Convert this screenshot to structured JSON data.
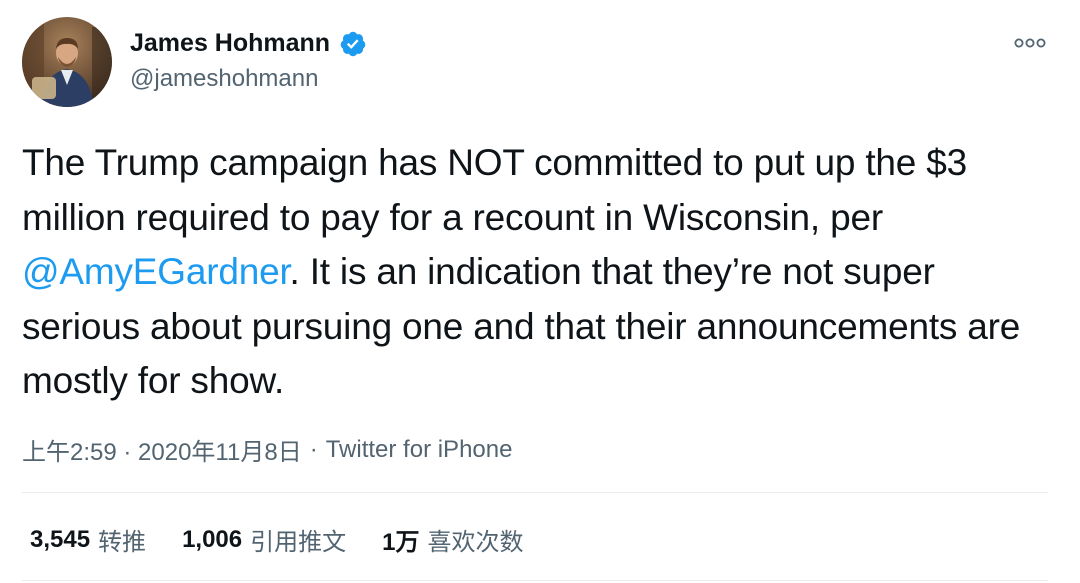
{
  "author": {
    "display_name": "James Hohmann",
    "handle": "@jameshohmann",
    "verified": true
  },
  "tweet": {
    "text_before_mention": "The Trump campaign has NOT committed to put up the $3 million required to pay for a recount in Wisconsin, per ",
    "mention": "@AmyEGardner",
    "text_after_mention": ". It is an indication that they’re not super serious about pursuing one and that their announcements are mostly for show."
  },
  "meta": {
    "timestamp": "上午2:59 · 2020年11月8日",
    "separator": "·",
    "source": "Twitter for iPhone"
  },
  "stats": [
    {
      "count": "3,545",
      "label": "转推"
    },
    {
      "count": "1,006",
      "label": "引用推文"
    },
    {
      "count": "1万",
      "label": "喜欢次数"
    }
  ],
  "icons": {
    "verified": "verified-badge-icon",
    "more": "more-options-icon"
  },
  "colors": {
    "link": "#1d9bf0",
    "secondary_text": "#536471",
    "primary_text": "#0f1419"
  }
}
